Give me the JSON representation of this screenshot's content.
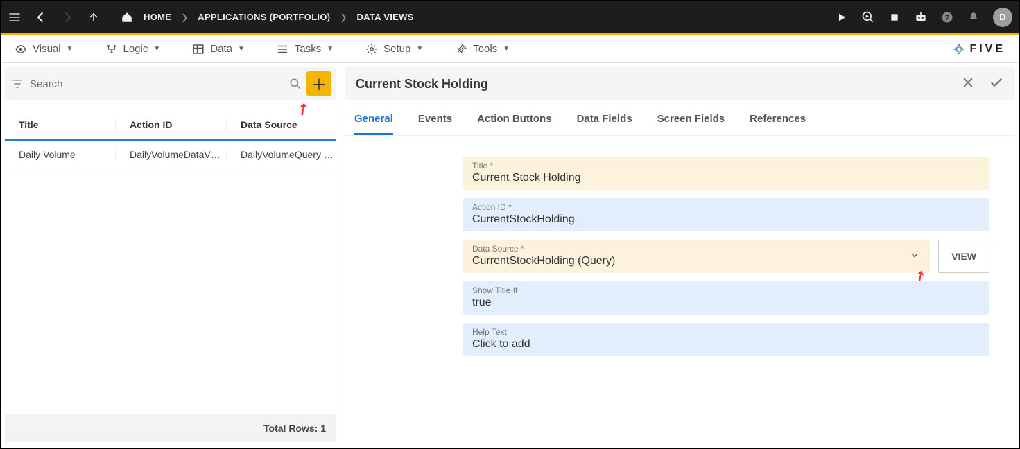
{
  "topbar": {
    "home": "HOME",
    "applications": "APPLICATIONS (PORTFOLIO)",
    "dataviews": "DATA VIEWS",
    "avatar_letter": "D"
  },
  "menubar": {
    "visual": "Visual",
    "logic": "Logic",
    "data": "Data",
    "tasks": "Tasks",
    "setup": "Setup",
    "tools": "Tools",
    "logo_text": "FIVE"
  },
  "left": {
    "search_placeholder": "Search",
    "columns": {
      "title": "Title",
      "action": "Action ID",
      "source": "Data Source"
    },
    "rows": [
      {
        "title": "Daily Volume",
        "action": "DailyVolumeDataV…",
        "source": "DailyVolumeQuery …"
      }
    ],
    "footer": "Total Rows: 1"
  },
  "detail": {
    "title": "Current Stock Holding",
    "tabs": {
      "general": "General",
      "events": "Events",
      "action_buttons": "Action Buttons",
      "data_fields": "Data Fields",
      "screen_fields": "Screen Fields",
      "references": "References"
    },
    "form": {
      "title_label": "Title *",
      "title_value": "Current Stock Holding",
      "actionid_label": "Action ID *",
      "actionid_value": "CurrentStockHolding",
      "datasource_label": "Data Source *",
      "datasource_value": "CurrentStockHolding (Query)",
      "view_btn": "VIEW",
      "showtitleif_label": "Show Title If",
      "showtitleif_value": "true",
      "helptext_label": "Help Text",
      "helptext_value": "Click to add"
    }
  }
}
